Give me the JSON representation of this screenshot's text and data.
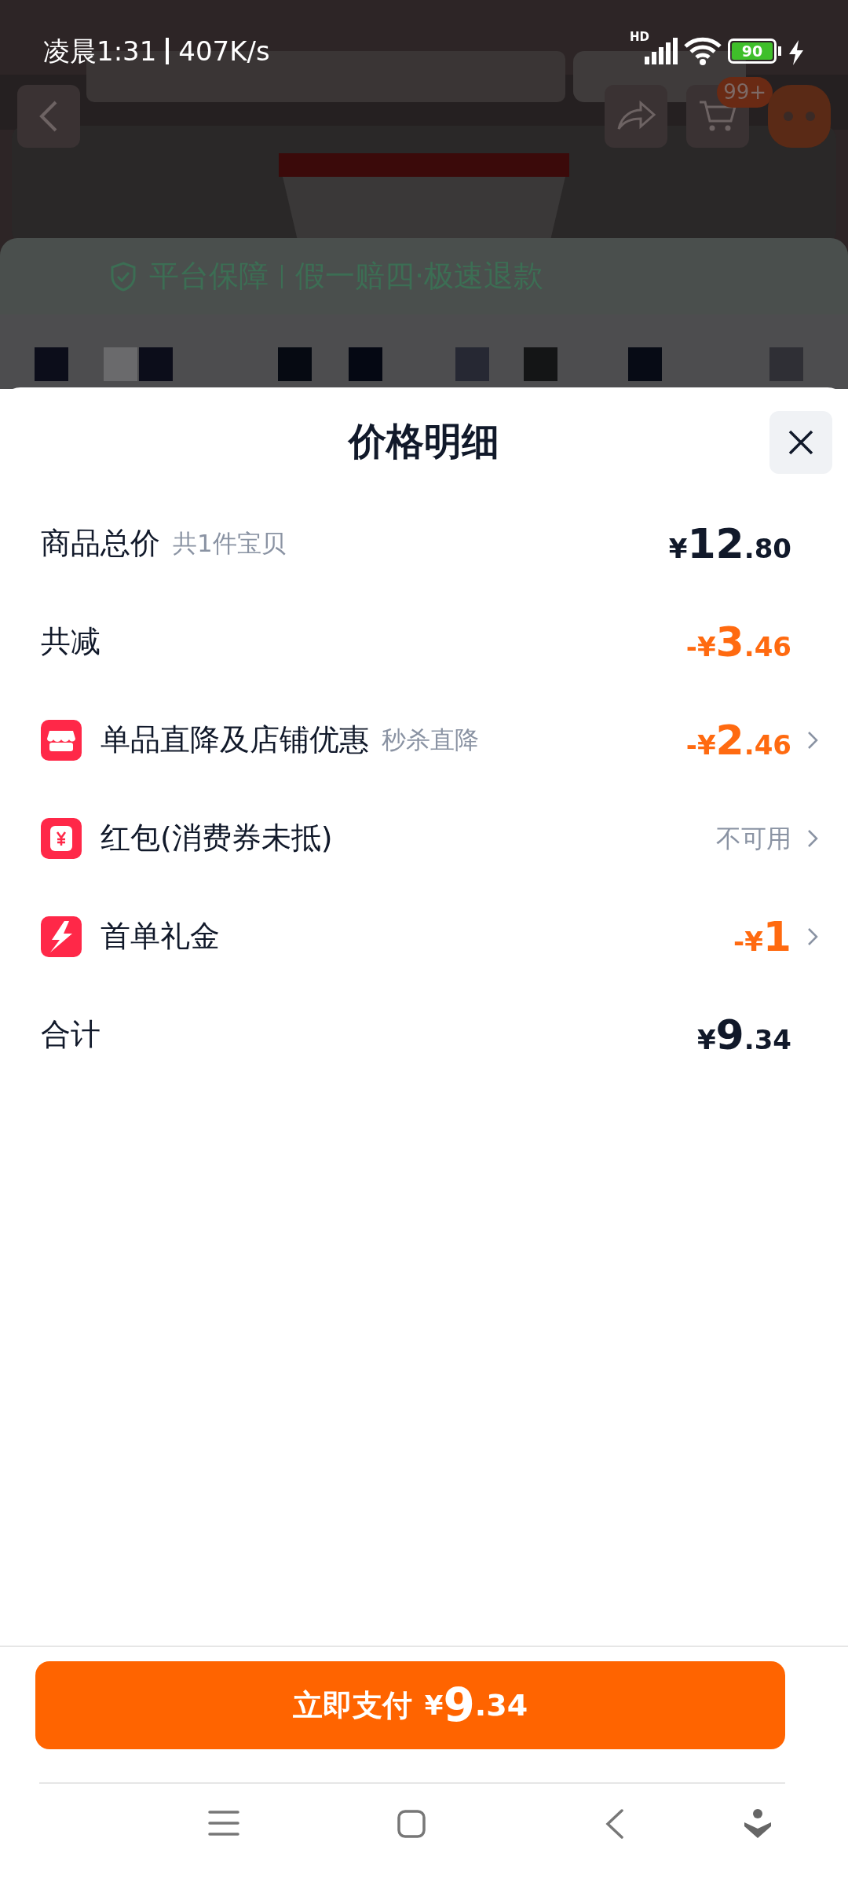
{
  "status_bar": {
    "time": "凌晨1:31",
    "speed": "407K/s",
    "network": "HD",
    "battery": "90",
    "charging": true
  },
  "background_page": {
    "cart_badge": "99+",
    "guarantee_title": "平台保障",
    "guarantee_text": "假一赔四·极速退款"
  },
  "sheet": {
    "title": "价格明细",
    "rows": [
      {
        "kind": "plain",
        "label": "商品总价",
        "note": "共1件宝贝",
        "amount": {
          "currency": "¥",
          "integer": "12",
          "decimal": ".80"
        },
        "highlighted": false,
        "arrow": false
      },
      {
        "kind": "plain",
        "label": "共减",
        "amount": {
          "sign": "-",
          "currency": "¥",
          "integer": "3",
          "decimal": ".46"
        },
        "highlighted": true,
        "arrow": false
      },
      {
        "kind": "store",
        "label": "单品直降及店铺优惠",
        "note": "秒杀直降",
        "amount": {
          "sign": "-",
          "currency": "¥",
          "integer": "2",
          "decimal": ".46"
        },
        "highlighted": true,
        "arrow": true
      },
      {
        "kind": "voucher",
        "label": "红包(消费券未抵)",
        "status": "不可用",
        "highlighted": false,
        "arrow": true
      },
      {
        "kind": "lightning",
        "label": "首单礼金",
        "amount": {
          "sign": "-",
          "currency": "¥",
          "integer": "1"
        },
        "highlighted": true,
        "arrow": true
      },
      {
        "kind": "plain",
        "label": "合计",
        "amount": {
          "currency": "¥",
          "integer": "9",
          "decimal": ".34"
        },
        "highlighted": false,
        "arrow": false
      }
    ],
    "pay_button": {
      "label": "立即支付",
      "amount": {
        "currency": "¥",
        "integer": "9",
        "decimal": ".34"
      }
    }
  }
}
